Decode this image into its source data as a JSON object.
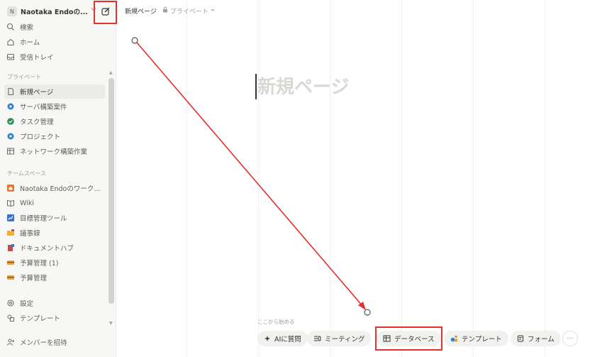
{
  "workspace": {
    "initial": "N",
    "name": "Naotaka Endoの..."
  },
  "sidebar": {
    "top_items": [
      {
        "label": "検索",
        "icon": "search-icon"
      },
      {
        "label": "ホーム",
        "icon": "home-icon"
      },
      {
        "label": "受信トレイ",
        "icon": "inbox-icon"
      }
    ],
    "private_section_label": "プライベート",
    "private_items": [
      {
        "label": "新規ページ",
        "icon": "page-icon",
        "active": true
      },
      {
        "label": "サーバ構築案件",
        "icon": "blue-gear-icon"
      },
      {
        "label": "タスク管理",
        "icon": "green-check-icon"
      },
      {
        "label": "プロジェクト",
        "icon": "blue-gear-icon"
      },
      {
        "label": "ネットワーク構築作業",
        "icon": "table-icon"
      }
    ],
    "teamspace_section_label": "チームスペース",
    "teamspace_items": [
      {
        "label": "Naotaka Endoのワーク...",
        "icon": "home-orange-icon"
      },
      {
        "label": "Wiki",
        "icon": "book-icon"
      },
      {
        "label": "目標管理ツール",
        "icon": "chart-icon"
      },
      {
        "label": "議事録",
        "icon": "folder-icon"
      },
      {
        "label": "ドキュメントハブ",
        "icon": "doc-hub-icon"
      },
      {
        "label": "予算管理 (1)",
        "icon": "budget-icon"
      },
      {
        "label": "予算管理",
        "icon": "budget-icon"
      }
    ],
    "bottom_items": [
      {
        "label": "設定",
        "icon": "gear-icon"
      },
      {
        "label": "テンプレート",
        "icon": "template-icon"
      },
      {
        "label": "メンバーを招待",
        "icon": "add-member-icon"
      }
    ]
  },
  "topbar": {
    "breadcrumb": "新規ページ",
    "privacy": "プライベート"
  },
  "page": {
    "title_placeholder": "新規ページ"
  },
  "start_bar": {
    "label": "ここから始める",
    "chips": [
      {
        "label": "AIに質問",
        "icon": "ai-icon"
      },
      {
        "label": "ミーティング",
        "icon": "meeting-icon"
      },
      {
        "label": "データベース",
        "icon": "database-icon"
      },
      {
        "label": "テンプレート",
        "icon": "template-shapes-icon"
      },
      {
        "label": "フォーム",
        "icon": "form-icon"
      }
    ],
    "more": "···"
  },
  "colors": {
    "highlight": "#e5302c",
    "sidebar_bg": "#f7f7f5"
  }
}
